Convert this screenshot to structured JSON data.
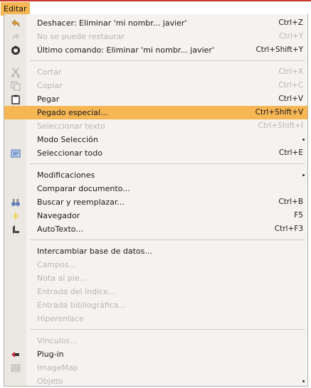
{
  "menubar": {
    "title": "Editar"
  },
  "groups": [
    {
      "items": [
        {
          "label": "Deshacer: Eliminar 'mi nombr... javier'",
          "shortcut": "Ctrl+Z",
          "icon": "undo-icon",
          "enabled": true
        },
        {
          "label": "No se puede restaurar",
          "shortcut": "Ctrl+Y",
          "icon": "redo-icon",
          "enabled": false
        },
        {
          "label": "Último comando: Eliminar 'mi nombr... javier'",
          "shortcut": "Ctrl+Shift+Y",
          "icon": "repeat-icon",
          "enabled": true
        }
      ]
    },
    {
      "items": [
        {
          "label": "Cortar",
          "shortcut": "Ctrl+X",
          "icon": "scissors-icon",
          "enabled": false
        },
        {
          "label": "Copiar",
          "shortcut": "Ctrl+C",
          "icon": "copy-icon",
          "enabled": false
        },
        {
          "label": "Pegar",
          "shortcut": "Ctrl+V",
          "icon": "clipboard-icon",
          "enabled": true
        },
        {
          "label": "Pegado especial...",
          "shortcut": "Ctrl+Shift+V",
          "icon": "",
          "enabled": true,
          "highlighted": true
        },
        {
          "label": "Seleccionar texto",
          "shortcut": "Ctrl+Shift+I",
          "icon": "",
          "enabled": false
        },
        {
          "label": "Modo Selección",
          "shortcut": "",
          "icon": "",
          "enabled": true,
          "submenu": true
        },
        {
          "label": "Seleccionar todo",
          "shortcut": "Ctrl+E",
          "icon": "select-all-icon",
          "enabled": true
        }
      ]
    },
    {
      "items": [
        {
          "label": "Modificaciones",
          "shortcut": "",
          "icon": "",
          "enabled": true,
          "submenu": true
        },
        {
          "label": "Comparar documento...",
          "shortcut": "",
          "icon": "",
          "enabled": true
        },
        {
          "label": "Buscar y reemplazar...",
          "shortcut": "Ctrl+B",
          "icon": "binoculars-icon",
          "enabled": true
        },
        {
          "label": "Navegador",
          "shortcut": "F5",
          "icon": "compass-icon",
          "enabled": true
        },
        {
          "label": "AutoTexto...",
          "shortcut": "Ctrl+F3",
          "icon": "autotext-icon",
          "enabled": true
        }
      ]
    },
    {
      "items": [
        {
          "label": "Intercambiar base de datos...",
          "shortcut": "",
          "icon": "",
          "enabled": true
        },
        {
          "label": "Campos...",
          "shortcut": "",
          "icon": "",
          "enabled": false
        },
        {
          "label": "Nota al pie...",
          "shortcut": "",
          "icon": "",
          "enabled": false
        },
        {
          "label": "Entrada del índice...",
          "shortcut": "",
          "icon": "",
          "enabled": false
        },
        {
          "label": "Entrada bibliográfica...",
          "shortcut": "",
          "icon": "",
          "enabled": false
        },
        {
          "label": "Hiperenlace",
          "shortcut": "",
          "icon": "",
          "enabled": false
        }
      ]
    },
    {
      "items": [
        {
          "label": "Vínculos...",
          "shortcut": "",
          "icon": "",
          "enabled": false
        },
        {
          "label": "Plug-in",
          "shortcut": "",
          "icon": "plugin-icon",
          "enabled": true
        },
        {
          "label": "ImageMap",
          "shortcut": "",
          "icon": "imagemap-icon",
          "enabled": false
        },
        {
          "label": "Objeto",
          "shortcut": "",
          "icon": "",
          "enabled": false,
          "submenu": true
        }
      ]
    }
  ],
  "accent_color": "#f6b654"
}
